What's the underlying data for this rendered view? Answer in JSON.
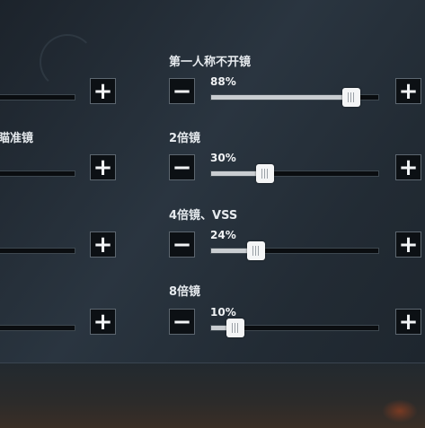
{
  "left_column": {
    "rows": [
      {
        "label": "",
        "plus_icon": "plus-icon"
      },
      {
        "label": "瞄准镜",
        "plus_icon": "plus-icon"
      },
      {
        "label": "",
        "plus_icon": "plus-icon"
      },
      {
        "label": "",
        "plus_icon": "plus-icon"
      }
    ]
  },
  "right_column": {
    "rows": [
      {
        "label": "第一人称不开镜",
        "value_text": "88%",
        "value": 0.88,
        "minus_icon": "minus-icon",
        "plus_icon": "plus-icon"
      },
      {
        "label": "2倍镜",
        "value_text": "30%",
        "value": 0.3,
        "minus_icon": "minus-icon",
        "plus_icon": "plus-icon"
      },
      {
        "label": "4倍镜、VSS",
        "value_text": "24%",
        "value": 0.24,
        "minus_icon": "minus-icon",
        "plus_icon": "plus-icon"
      },
      {
        "label": "8倍镜",
        "value_text": "10%",
        "value": 0.1,
        "minus_icon": "minus-icon",
        "plus_icon": "plus-icon"
      }
    ]
  },
  "colors": {
    "track": "#0a0d10",
    "fill": "#c9cdd1",
    "thumb": "#f4f5f6",
    "button_bg": "#0c1014"
  }
}
